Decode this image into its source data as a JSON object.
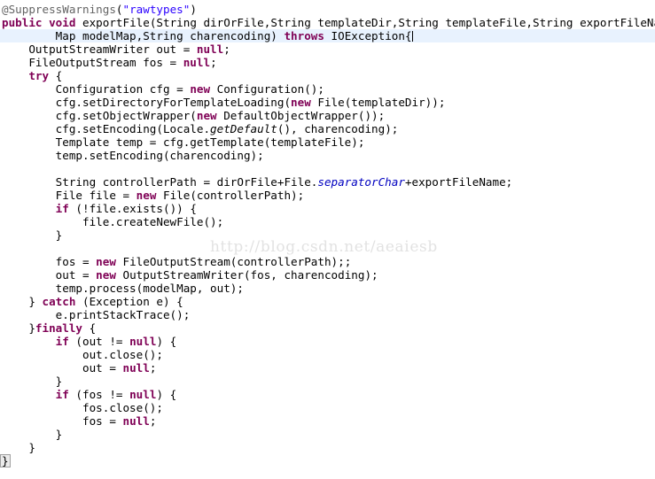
{
  "editor": {
    "name": "java-code-editor",
    "language": "Java",
    "colors": {
      "background": "#ffffff",
      "foreground": "#000000",
      "keyword": "#7f0055",
      "string": "#2a00ff",
      "annotation": "#646464",
      "static_field": "#0000c0",
      "current_line_highlight": "#e8f2fe",
      "bracket_match_border": "#a0a0a0",
      "bracket_match_fill": "#ebebeb",
      "watermark": "#e2e2e2"
    },
    "caret_line_index": 2,
    "caret_after_text": "IOException{"
  },
  "watermark": {
    "text": "http://blog.csdn.net/aeaiesb"
  },
  "code_lines": [
    {
      "index": 0,
      "current": false,
      "tokens": [
        {
          "t": "@SuppressWarnings",
          "c": "ann"
        },
        {
          "t": "(",
          "c": "plain"
        },
        {
          "t": "\"rawtypes\"",
          "c": "str"
        },
        {
          "t": ")",
          "c": "plain"
        }
      ]
    },
    {
      "index": 1,
      "current": false,
      "tokens": [
        {
          "t": "public",
          "c": "kw"
        },
        {
          "t": " ",
          "c": "plain"
        },
        {
          "t": "void",
          "c": "kw"
        },
        {
          "t": " exportFile(String dirOrFile,String templateDir,String templateFile,String exportFileName,",
          "c": "plain"
        }
      ]
    },
    {
      "index": 2,
      "current": true,
      "tokens": [
        {
          "t": "        Map modelMap,String charencoding) ",
          "c": "plain"
        },
        {
          "t": "throws",
          "c": "kw"
        },
        {
          "t": " IOException{",
          "c": "plain"
        }
      ]
    },
    {
      "index": 3,
      "current": false,
      "tokens": [
        {
          "t": "    OutputStreamWriter out = ",
          "c": "plain"
        },
        {
          "t": "null",
          "c": "kw"
        },
        {
          "t": ";",
          "c": "plain"
        }
      ]
    },
    {
      "index": 4,
      "current": false,
      "tokens": [
        {
          "t": "    FileOutputStream fos = ",
          "c": "plain"
        },
        {
          "t": "null",
          "c": "kw"
        },
        {
          "t": ";",
          "c": "plain"
        }
      ]
    },
    {
      "index": 5,
      "current": false,
      "tokens": [
        {
          "t": "    ",
          "c": "plain"
        },
        {
          "t": "try",
          "c": "kw"
        },
        {
          "t": " {",
          "c": "plain"
        }
      ]
    },
    {
      "index": 6,
      "current": false,
      "tokens": [
        {
          "t": "        Configuration cfg = ",
          "c": "plain"
        },
        {
          "t": "new",
          "c": "kw"
        },
        {
          "t": " Configuration();",
          "c": "plain"
        }
      ]
    },
    {
      "index": 7,
      "current": false,
      "tokens": [
        {
          "t": "        cfg.setDirectoryForTemplateLoading(",
          "c": "plain"
        },
        {
          "t": "new",
          "c": "kw"
        },
        {
          "t": " File(templateDir));",
          "c": "plain"
        }
      ]
    },
    {
      "index": 8,
      "current": false,
      "tokens": [
        {
          "t": "        cfg.setObjectWrapper(",
          "c": "plain"
        },
        {
          "t": "new",
          "c": "kw"
        },
        {
          "t": " DefaultObjectWrapper());",
          "c": "plain"
        }
      ]
    },
    {
      "index": 9,
      "current": false,
      "tokens": [
        {
          "t": "        cfg.setEncoding(Locale.",
          "c": "plain"
        },
        {
          "t": "getDefault",
          "c": "statm"
        },
        {
          "t": "(), charencoding);",
          "c": "plain"
        }
      ]
    },
    {
      "index": 10,
      "current": false,
      "tokens": [
        {
          "t": "        Template temp = cfg.getTemplate(templateFile);",
          "c": "plain"
        }
      ]
    },
    {
      "index": 11,
      "current": false,
      "tokens": [
        {
          "t": "        temp.setEncoding(charencoding);",
          "c": "plain"
        }
      ]
    },
    {
      "index": 12,
      "current": false,
      "tokens": [
        {
          "t": "",
          "c": "plain"
        }
      ]
    },
    {
      "index": 13,
      "current": false,
      "tokens": [
        {
          "t": "        String controllerPath = dirOrFile+File.",
          "c": "plain"
        },
        {
          "t": "separatorChar",
          "c": "stat"
        },
        {
          "t": "+exportFileName;",
          "c": "plain"
        }
      ]
    },
    {
      "index": 14,
      "current": false,
      "tokens": [
        {
          "t": "        File file = ",
          "c": "plain"
        },
        {
          "t": "new",
          "c": "kw"
        },
        {
          "t": " File(controllerPath);",
          "c": "plain"
        }
      ]
    },
    {
      "index": 15,
      "current": false,
      "tokens": [
        {
          "t": "        ",
          "c": "plain"
        },
        {
          "t": "if",
          "c": "kw"
        },
        {
          "t": " (!file.exists()) {",
          "c": "plain"
        }
      ]
    },
    {
      "index": 16,
      "current": false,
      "tokens": [
        {
          "t": "            file.createNewFile();",
          "c": "plain"
        }
      ]
    },
    {
      "index": 17,
      "current": false,
      "tokens": [
        {
          "t": "        }",
          "c": "plain"
        }
      ]
    },
    {
      "index": 18,
      "current": false,
      "tokens": [
        {
          "t": "",
          "c": "plain"
        }
      ]
    },
    {
      "index": 19,
      "current": false,
      "tokens": [
        {
          "t": "        fos = ",
          "c": "plain"
        },
        {
          "t": "new",
          "c": "kw"
        },
        {
          "t": " FileOutputStream(controllerPath);;",
          "c": "plain"
        }
      ]
    },
    {
      "index": 20,
      "current": false,
      "tokens": [
        {
          "t": "        out = ",
          "c": "plain"
        },
        {
          "t": "new",
          "c": "kw"
        },
        {
          "t": " OutputStreamWriter(fos, charencoding);",
          "c": "plain"
        }
      ]
    },
    {
      "index": 21,
      "current": false,
      "tokens": [
        {
          "t": "        temp.process(modelMap, out);",
          "c": "plain"
        }
      ]
    },
    {
      "index": 22,
      "current": false,
      "tokens": [
        {
          "t": "    } ",
          "c": "plain"
        },
        {
          "t": "catch",
          "c": "kw"
        },
        {
          "t": " (Exception e) {",
          "c": "plain"
        }
      ]
    },
    {
      "index": 23,
      "current": false,
      "tokens": [
        {
          "t": "        e.printStackTrace();",
          "c": "plain"
        }
      ]
    },
    {
      "index": 24,
      "current": false,
      "tokens": [
        {
          "t": "    }",
          "c": "plain"
        },
        {
          "t": "finally",
          "c": "kw"
        },
        {
          "t": " {",
          "c": "plain"
        }
      ]
    },
    {
      "index": 25,
      "current": false,
      "tokens": [
        {
          "t": "        ",
          "c": "plain"
        },
        {
          "t": "if",
          "c": "kw"
        },
        {
          "t": " (out != ",
          "c": "plain"
        },
        {
          "t": "null",
          "c": "kw"
        },
        {
          "t": ") {",
          "c": "plain"
        }
      ]
    },
    {
      "index": 26,
      "current": false,
      "tokens": [
        {
          "t": "            out.close();",
          "c": "plain"
        }
      ]
    },
    {
      "index": 27,
      "current": false,
      "tokens": [
        {
          "t": "            out = ",
          "c": "plain"
        },
        {
          "t": "null",
          "c": "kw"
        },
        {
          "t": ";",
          "c": "plain"
        }
      ]
    },
    {
      "index": 28,
      "current": false,
      "tokens": [
        {
          "t": "        }",
          "c": "plain"
        }
      ]
    },
    {
      "index": 29,
      "current": false,
      "tokens": [
        {
          "t": "        ",
          "c": "plain"
        },
        {
          "t": "if",
          "c": "kw"
        },
        {
          "t": " (fos != ",
          "c": "plain"
        },
        {
          "t": "null",
          "c": "kw"
        },
        {
          "t": ") {",
          "c": "plain"
        }
      ]
    },
    {
      "index": 30,
      "current": false,
      "tokens": [
        {
          "t": "            fos.close();",
          "c": "plain"
        }
      ]
    },
    {
      "index": 31,
      "current": false,
      "tokens": [
        {
          "t": "            fos = ",
          "c": "plain"
        },
        {
          "t": "null",
          "c": "kw"
        },
        {
          "t": ";",
          "c": "plain"
        }
      ]
    },
    {
      "index": 32,
      "current": false,
      "tokens": [
        {
          "t": "        }",
          "c": "plain"
        }
      ]
    },
    {
      "index": 33,
      "current": false,
      "tokens": [
        {
          "t": "    }",
          "c": "plain"
        }
      ]
    },
    {
      "index": 34,
      "current": false,
      "bracket_match": true,
      "tokens": [
        {
          "t": "}",
          "c": "plain"
        }
      ]
    }
  ]
}
